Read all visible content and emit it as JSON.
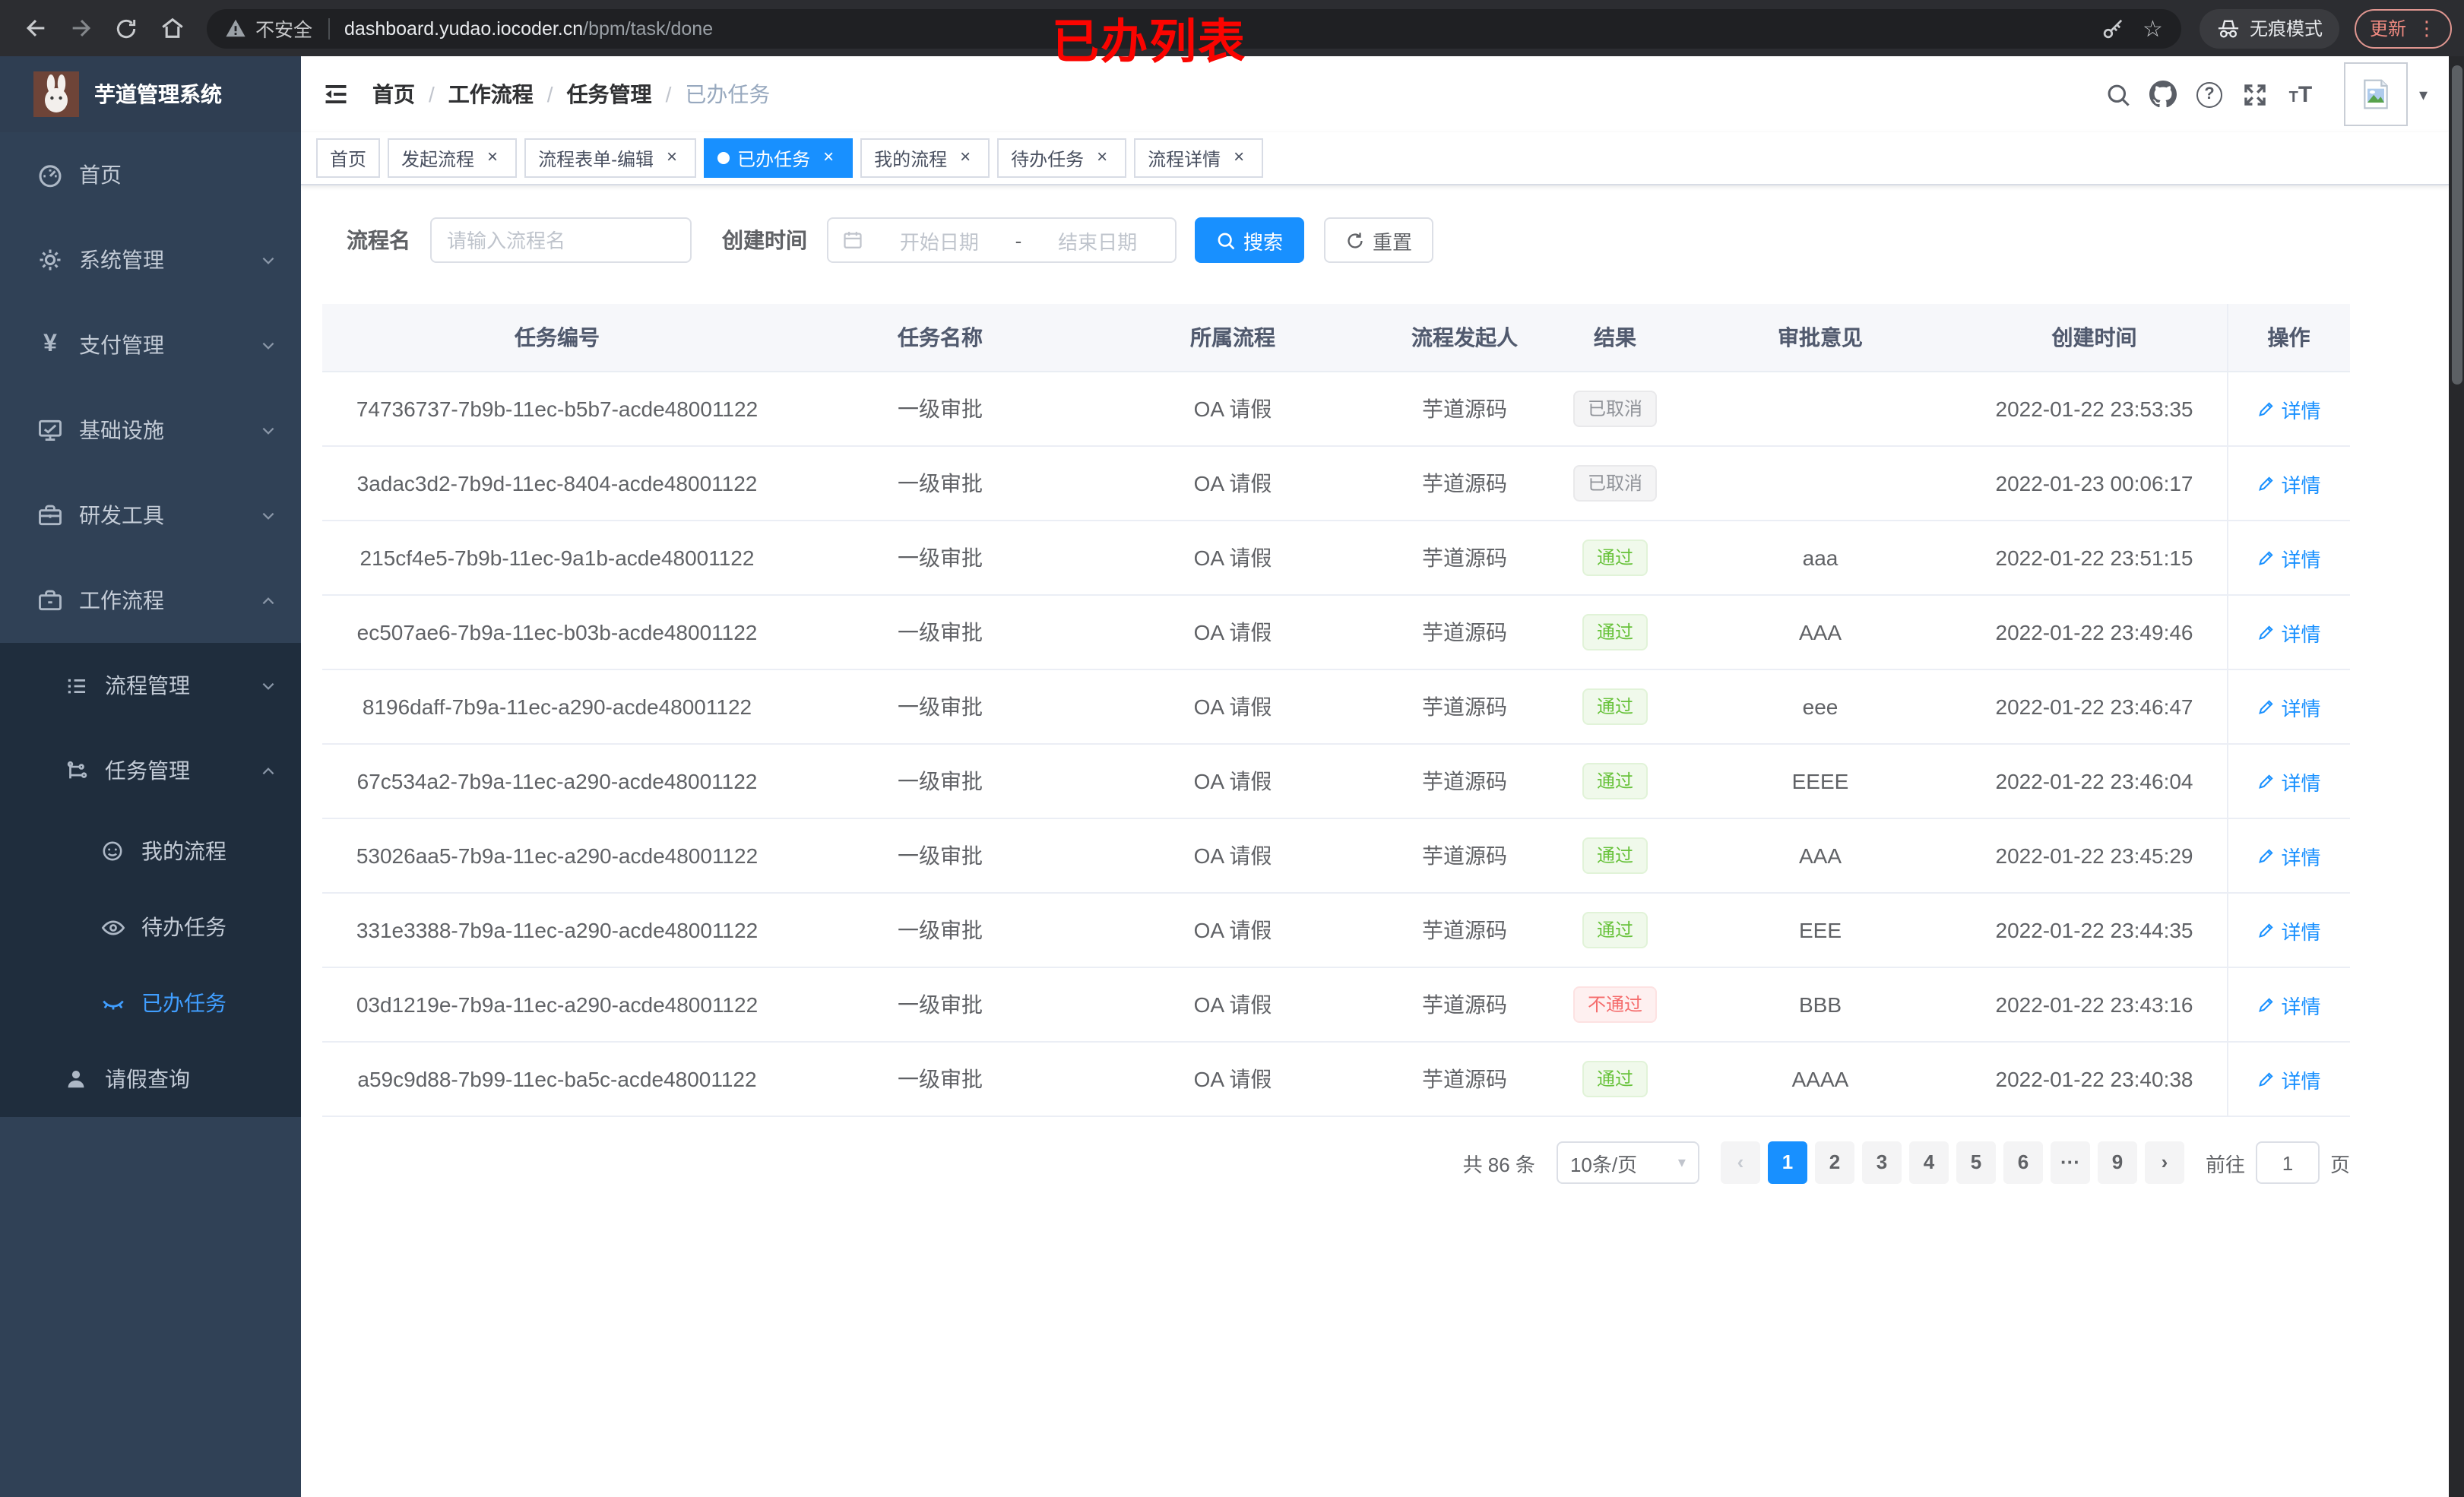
{
  "ui": {
    "close": "×",
    "sep": "/",
    "caret_down": "▾",
    "star": "☆",
    "dots_v": "⋮",
    "prev": "‹",
    "next": "›",
    "question": "?"
  },
  "browser": {
    "security_label": "不安全",
    "url_host": "dashboard.yudao.iocoder.cn",
    "url_path": "/bpm/task/done",
    "incognito_label": "无痕模式",
    "update_label": "更新"
  },
  "annotation": {
    "text": "已办列表",
    "color": "#fb0400"
  },
  "sidebar": {
    "app_title": "芋道管理系统",
    "items": [
      {
        "label": "首页"
      },
      {
        "label": "系统管理"
      },
      {
        "label": "支付管理"
      },
      {
        "label": "基础设施"
      },
      {
        "label": "研发工具"
      },
      {
        "label": "工作流程"
      }
    ],
    "sub": {
      "process_mgmt": "流程管理",
      "task_mgmt": "任务管理",
      "my_process": "我的流程",
      "todo_task": "待办任务",
      "done_task": "已办任务",
      "leave_query": "请假查询"
    }
  },
  "header": {
    "breadcrumb": [
      "首页",
      "工作流程",
      "任务管理",
      "已办任务"
    ]
  },
  "tabs": {
    "items": [
      {
        "label": "首页"
      },
      {
        "label": "发起流程"
      },
      {
        "label": "流程表单-编辑"
      },
      {
        "label": "已办任务"
      },
      {
        "label": "我的流程"
      },
      {
        "label": "待办任务"
      },
      {
        "label": "流程详情"
      }
    ]
  },
  "filters": {
    "name_label": "流程名",
    "name_placeholder": "请输入流程名",
    "date_label": "创建时间",
    "date_start_placeholder": "开始日期",
    "date_separator": "-",
    "date_end_placeholder": "结束日期",
    "search_label": "搜索",
    "reset_label": "重置"
  },
  "table": {
    "columns": [
      "任务编号",
      "任务名称",
      "所属流程",
      "流程发起人",
      "结果",
      "审批意见",
      "创建时间",
      "操作"
    ],
    "action_label": "详情",
    "rows": [
      {
        "id": "74736737-7b9b-11ec-b5b7-acde48001122",
        "name": "一级审批",
        "flow": "OA 请假",
        "starter": "芋道源码",
        "result": "已取消",
        "result_type": "info",
        "comment": "",
        "created": "2022-01-22 23:53:35"
      },
      {
        "id": "3adac3d2-7b9d-11ec-8404-acde48001122",
        "name": "一级审批",
        "flow": "OA 请假",
        "starter": "芋道源码",
        "result": "已取消",
        "result_type": "info",
        "comment": "",
        "created": "2022-01-23 00:06:17"
      },
      {
        "id": "215cf4e5-7b9b-11ec-9a1b-acde48001122",
        "name": "一级审批",
        "flow": "OA 请假",
        "starter": "芋道源码",
        "result": "通过",
        "result_type": "success",
        "comment": "aaa",
        "created": "2022-01-22 23:51:15"
      },
      {
        "id": "ec507ae6-7b9a-11ec-b03b-acde48001122",
        "name": "一级审批",
        "flow": "OA 请假",
        "starter": "芋道源码",
        "result": "通过",
        "result_type": "success",
        "comment": "AAA",
        "created": "2022-01-22 23:49:46"
      },
      {
        "id": "8196daff-7b9a-11ec-a290-acde48001122",
        "name": "一级审批",
        "flow": "OA 请假",
        "starter": "芋道源码",
        "result": "通过",
        "result_type": "success",
        "comment": "eee",
        "created": "2022-01-22 23:46:47"
      },
      {
        "id": "67c534a2-7b9a-11ec-a290-acde48001122",
        "name": "一级审批",
        "flow": "OA 请假",
        "starter": "芋道源码",
        "result": "通过",
        "result_type": "success",
        "comment": "EEEE",
        "created": "2022-01-22 23:46:04"
      },
      {
        "id": "53026aa5-7b9a-11ec-a290-acde48001122",
        "name": "一级审批",
        "flow": "OA 请假",
        "starter": "芋道源码",
        "result": "通过",
        "result_type": "success",
        "comment": "AAA",
        "created": "2022-01-22 23:45:29"
      },
      {
        "id": "331e3388-7b9a-11ec-a290-acde48001122",
        "name": "一级审批",
        "flow": "OA 请假",
        "starter": "芋道源码",
        "result": "通过",
        "result_type": "success",
        "comment": "EEE",
        "created": "2022-01-22 23:44:35"
      },
      {
        "id": "03d1219e-7b9a-11ec-a290-acde48001122",
        "name": "一级审批",
        "flow": "OA 请假",
        "starter": "芋道源码",
        "result": "不通过",
        "result_type": "danger",
        "comment": "BBB",
        "created": "2022-01-22 23:43:16"
      },
      {
        "id": "a59c9d88-7b99-11ec-ba5c-acde48001122",
        "name": "一级审批",
        "flow": "OA 请假",
        "starter": "芋道源码",
        "result": "通过",
        "result_type": "success",
        "comment": "AAAA",
        "created": "2022-01-22 23:40:38"
      }
    ]
  },
  "pagination": {
    "total_text": "共 86 条",
    "page_size": "10条/页",
    "pages": [
      "1",
      "2",
      "3",
      "4",
      "5",
      "6",
      "···",
      "9"
    ],
    "active_page": "1",
    "goto_label": "前往",
    "goto_value": "1",
    "page_unit": "页"
  },
  "colors": {
    "accent": "#1890ff",
    "active_menu": "#409eff",
    "success": "#67c23a",
    "danger": "#f56c6c",
    "info": "#909399",
    "sidebar_bg": "#304156",
    "submenu_bg": "#1f2d3d"
  }
}
